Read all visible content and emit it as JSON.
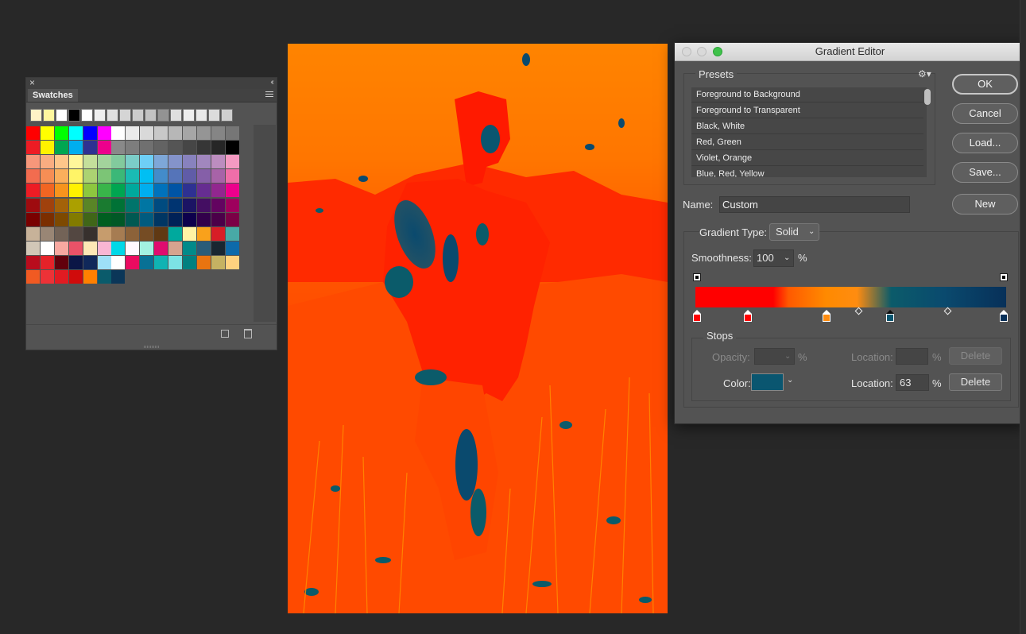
{
  "swatches_panel": {
    "tab_label": "Swatches",
    "close_icon": "close-icon",
    "recent": [
      "#fff2c6",
      "#fff79e",
      "#ffffff",
      "#000000",
      "#ffffff",
      "#efefef",
      "#e0e0e0",
      "#d5d5d5",
      "#cccccc",
      "#c2c2c2",
      "#939393",
      "#dfdfdf",
      "#eeeeee",
      "#e8e8e8",
      "#dcdcdc",
      "#cfcfcf"
    ],
    "rows": [
      [
        "#ff0000",
        "#ffff00",
        "#00ff00",
        "#00ffff",
        "#0000ff",
        "#ff00ff",
        "#ffffff",
        "#ebebeb",
        "#d9d9d9",
        "#c8c8c8",
        "#b7b7b7",
        "#a6a6a6",
        "#959595",
        "#858585",
        "#767676"
      ],
      [
        "#ed1c24",
        "#fff200",
        "#00a651",
        "#00aeef",
        "#2e3192",
        "#ec008c",
        "#898989",
        "#7d7d7d",
        "#707070",
        "#636363",
        "#555555",
        "#464646",
        "#363636",
        "#262626",
        "#000000"
      ],
      [
        "#f7977a",
        "#f9ad81",
        "#fdc68a",
        "#fff79a",
        "#c4df9b",
        "#a3d39c",
        "#82ca9d",
        "#7bcdc8",
        "#6ecff6",
        "#7ea7d8",
        "#8493ca",
        "#8882be",
        "#a187be",
        "#bc8dbf",
        "#f49ac2"
      ],
      [
        "#f26c4f",
        "#f68e55",
        "#fbaf5c",
        "#fff467",
        "#acd372",
        "#7cc576",
        "#3bb878",
        "#1abbb4",
        "#00bff3",
        "#438cca",
        "#5574b9",
        "#605ca8",
        "#855fa8",
        "#a763a8",
        "#f06ea9"
      ],
      [
        "#ed1c24",
        "#f26522",
        "#f7941d",
        "#fff200",
        "#8dc73f",
        "#39b54a",
        "#00a651",
        "#00a99d",
        "#00aeef",
        "#0072bc",
        "#0054a5",
        "#2e3192",
        "#662d91",
        "#92278f",
        "#ec008c"
      ],
      [
        "#9e0b0f",
        "#a0410d",
        "#a36209",
        "#aba000",
        "#598527",
        "#1a7b30",
        "#007236",
        "#00746b",
        "#0076a3",
        "#004b80",
        "#003471",
        "#1b1464",
        "#440e62",
        "#630460",
        "#9e005d"
      ],
      [
        "#790000",
        "#7b2e00",
        "#7d4900",
        "#827b00",
        "#406618",
        "#005e20",
        "#005826",
        "#005952",
        "#005b7f",
        "#003663",
        "#002157",
        "#0d004c",
        "#32004b",
        "#4b0049",
        "#7b0046"
      ],
      [
        "#c7b299",
        "#998675",
        "#736357",
        "#534741",
        "#37302d",
        "#c69c6d",
        "#a67c52",
        "#8c6239",
        "#754c24",
        "#603913",
        "#00a99d",
        "#fff3a5",
        "#f9a11b",
        "#d71d26",
        "#48a9a6"
      ],
      [
        "#d1c7b7",
        "#ffffff",
        "#f7a8a0",
        "#ea5268",
        "#fde8b6",
        "#f9b6d4",
        "#00d8e8",
        "#fff8ff",
        "#a2f2e2",
        "#e00c6f",
        "#d6a38f",
        "#018a8a",
        "#2a5c78",
        "#192631",
        "#0d6aaa"
      ],
      [
        "#b90c1d",
        "#e52229",
        "#62000c",
        "#0b1646",
        "#10285a",
        "#9ee0f7",
        "#ffffff",
        "#eb0b60",
        "#087195",
        "#10b3b3",
        "#7ce3e5",
        "#008080",
        "#e97410",
        "#c5b262",
        "#ffd27f"
      ],
      [
        "#f15a22",
        "#ed3237",
        "#e11b22",
        "#d00b0b",
        "#ff8000",
        "#0a5b6b",
        "#0b3658"
      ]
    ]
  },
  "gradient_editor": {
    "title": "Gradient Editor",
    "presets_label": "Presets",
    "preset_gear_icon": "gear-icon",
    "presets": [
      "Foreground to Background",
      "Foreground to Transparent",
      "Black, White",
      "Red, Green",
      "Violet, Orange",
      "Blue, Red, Yellow"
    ],
    "buttons": {
      "ok": "OK",
      "cancel": "Cancel",
      "load": "Load...",
      "save": "Save...",
      "new": "New"
    },
    "name_label": "Name:",
    "name_value": "Custom",
    "gradient_type_label": "Gradient Type:",
    "gradient_type_value": "Solid",
    "smoothness_label": "Smoothness:",
    "smoothness_value": "100",
    "smoothness_unit": "%",
    "stops_label": "Stops",
    "opacity_label": "Opacity:",
    "opacity_value": "",
    "opacity_unit": "%",
    "opacity_location_label": "Location:",
    "opacity_location_value": "",
    "opacity_location_unit": "%",
    "opacity_delete": "Delete",
    "color_label": "Color:",
    "color_value": "#0a5670",
    "color_location_label": "Location:",
    "color_location_value": "63",
    "color_location_unit": "%",
    "color_delete": "Delete",
    "color_stops": [
      {
        "location": 0,
        "color": "#ff0000"
      },
      {
        "location": 17,
        "color": "#ff0000"
      },
      {
        "location": 42,
        "color": "#ff8c10"
      },
      {
        "location": 63,
        "color": "#0a5670",
        "selected": true
      },
      {
        "location": 100,
        "color": "#073059"
      }
    ],
    "opacity_stops": [
      0,
      100
    ]
  }
}
